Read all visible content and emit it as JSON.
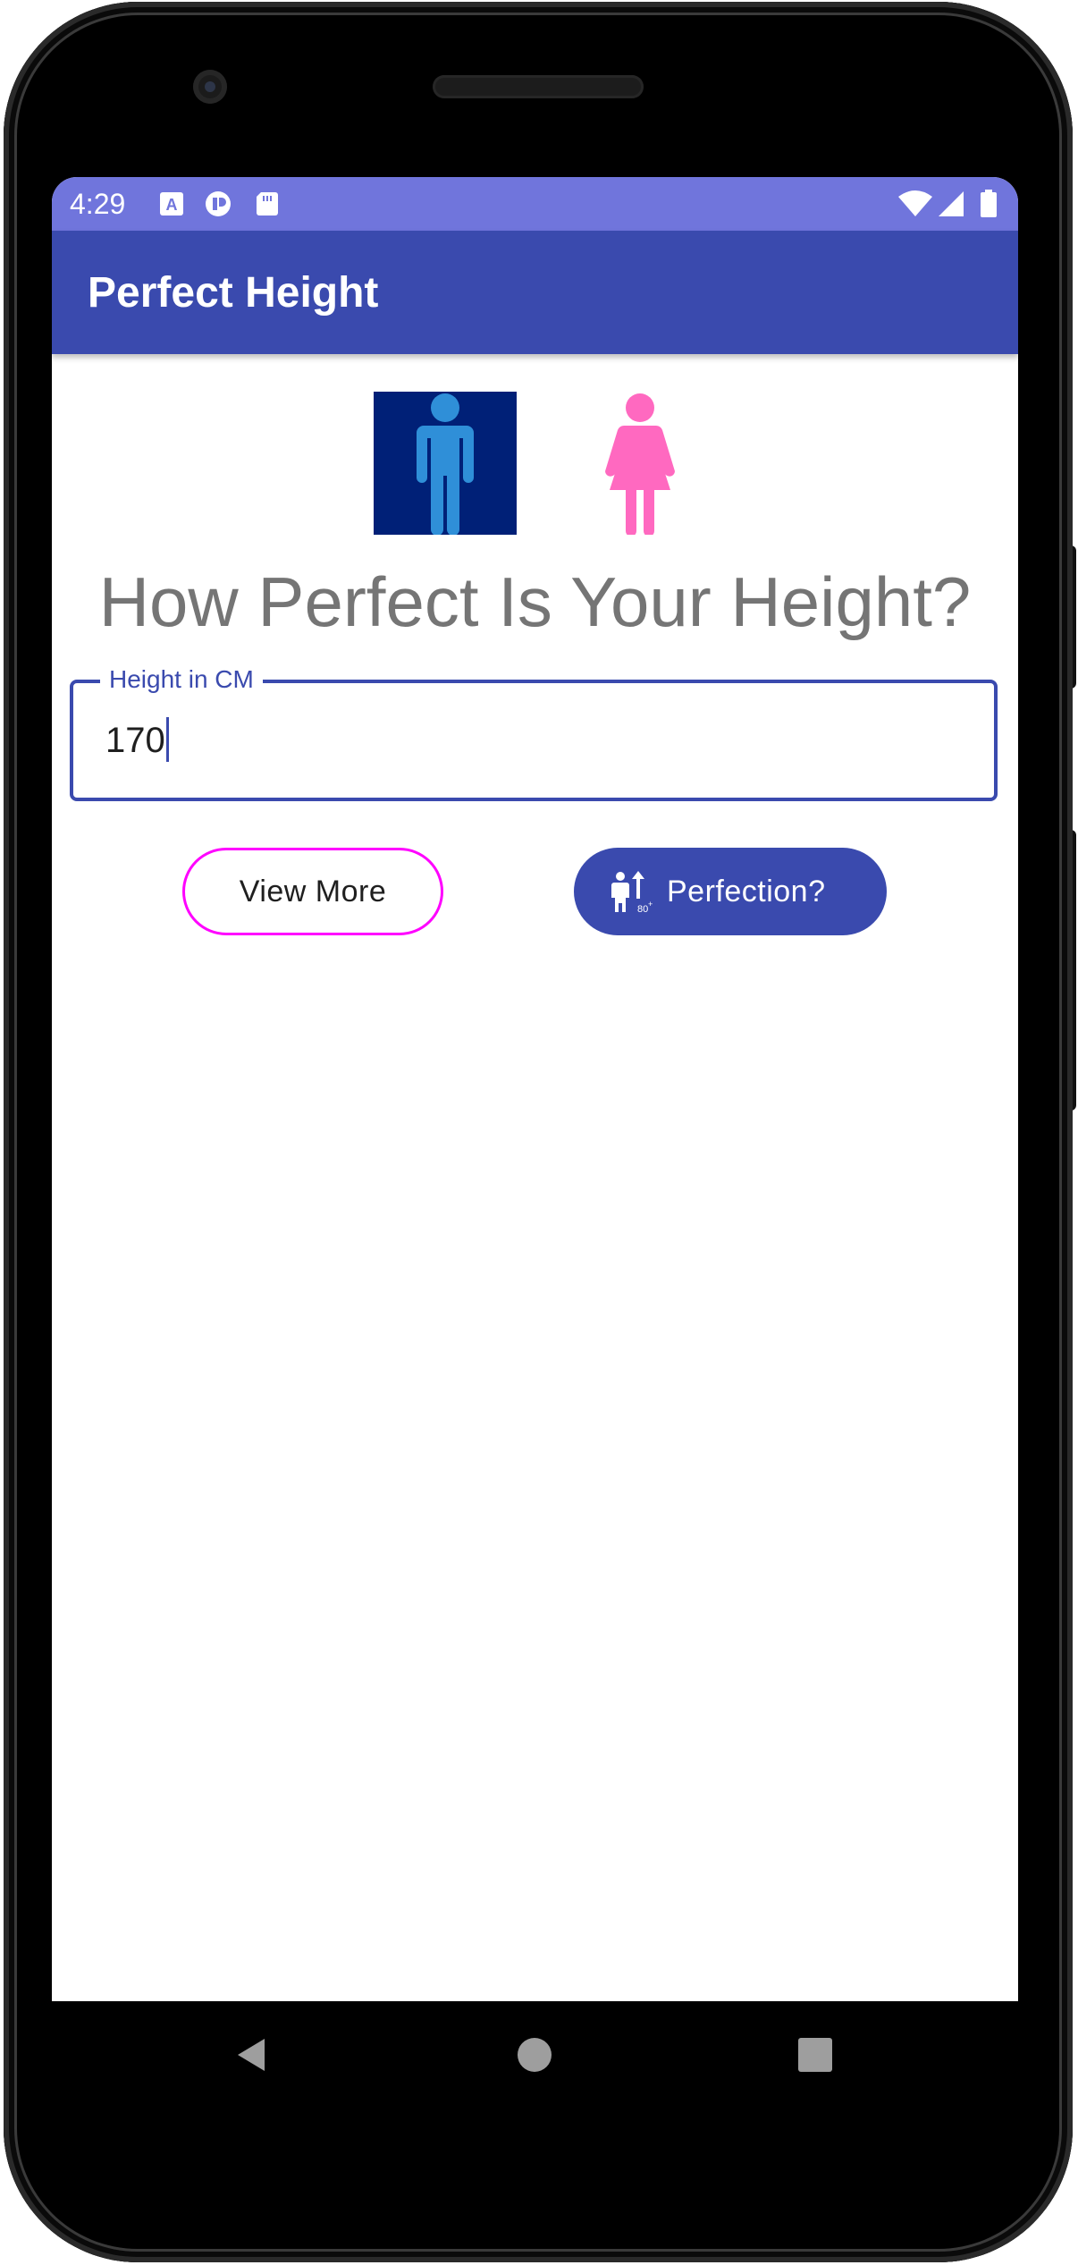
{
  "status_bar": {
    "time": "4:29",
    "left_icons": [
      "font-notification-icon",
      "record-icon",
      "sd-card-icon"
    ],
    "right_icons": [
      "wifi-icon",
      "cell-signal-icon",
      "battery-icon"
    ],
    "background_color": "#7075dc"
  },
  "app_bar": {
    "title": "Perfect Height",
    "background_color": "#3a4aae"
  },
  "gender_selector": {
    "male_icon": "male-person-icon",
    "female_icon": "female-person-icon",
    "male_color": "#2f8fd8",
    "male_background": "#002077",
    "female_color": "#ff69c0"
  },
  "main": {
    "headline": "How Perfect Is Your Height?",
    "height_field": {
      "label": "Height in CM",
      "value": "170"
    },
    "view_more_button": {
      "label": "View More",
      "border_color": "#ff00ff"
    },
    "perfection_button": {
      "label": "Perfection?",
      "icon": "height-measure-icon"
    }
  },
  "nav_bar": {
    "buttons": [
      "back-icon",
      "home-icon",
      "recents-icon"
    ]
  }
}
